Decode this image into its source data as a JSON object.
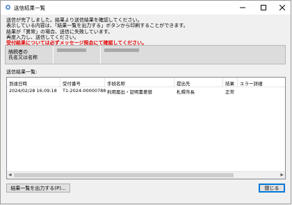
{
  "window": {
    "title": "送信結果一覧"
  },
  "message": {
    "lines": [
      "送信が完了しました。結果より送信結果を確認してください。",
      "表示している内容は、「結果一覧を出力する」ボタンから印刷することができます。",
      "結果が「異常」の場合、送信に失敗しています。",
      "再度入力し、送信してください。"
    ],
    "warning": "受付結果については必ずメッセージ照会にて確認してください。"
  },
  "payer": {
    "label_line1": "納税者の",
    "label_line2": "氏名又は名称"
  },
  "results": {
    "label": "送信結果一覧:",
    "columns": [
      "到達日時",
      "受付番号",
      "手続名称",
      "提出先",
      "結果",
      "エラー詳細"
    ],
    "rows": [
      {
        "datetime": "2024/02/28 16:09:18",
        "receipt_no": "T1-2024-00000788",
        "procedure": "利用届出・証明書差替",
        "destination": "札幌市長",
        "result": "正常",
        "error": ""
      }
    ]
  },
  "buttons": {
    "export": "結果一覧を出力する(P)...",
    "close": "閉じる"
  }
}
